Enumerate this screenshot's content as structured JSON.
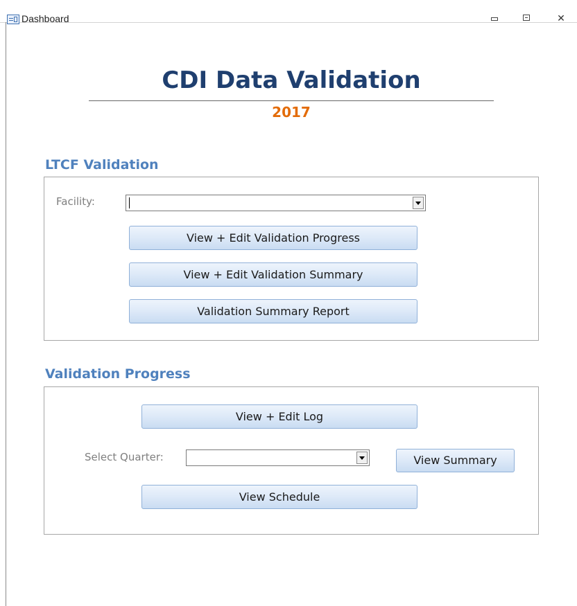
{
  "window": {
    "title": "Dashboard",
    "controls": {
      "minimize": "minimize",
      "maximize": "maximize",
      "close": "✕"
    }
  },
  "header": {
    "title": "CDI Data Validation",
    "year": "2017"
  },
  "ltcf_section": {
    "heading": "LTCF Validation",
    "facility_label": "Facility:",
    "facility_value": "",
    "buttons": {
      "progress": "View + Edit Validation Progress",
      "summary": "View + Edit Validation Summary",
      "report": "Validation Summary Report"
    }
  },
  "progress_section": {
    "heading": "Validation Progress",
    "log_button": "View + Edit Log",
    "quarter_label": "Select Quarter:",
    "quarter_value": "",
    "view_summary_button": "View Summary",
    "schedule_button": "View Schedule"
  },
  "colors": {
    "title": "#1f3f6f",
    "year": "#e36c0a",
    "section_heading": "#4f81bd",
    "label": "#7f7f7f",
    "button_border": "#8fb0d8"
  },
  "icons": {
    "app": "form-icon",
    "dropdown": "chevron-down-icon"
  }
}
